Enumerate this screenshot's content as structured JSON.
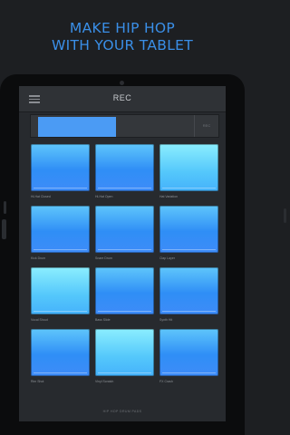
{
  "promo": {
    "line1": "MAKE HIP HOP",
    "line2": "WITH YOUR TABLET",
    "accent_color": "#3a8fe8"
  },
  "app": {
    "title": "REC",
    "menu_icon": "hamburger-menu-icon",
    "transport_button": "REC",
    "meter_color": "#4b9bf4",
    "pads": [
      {
        "label": "Hi-Hat Closed",
        "style": "blue"
      },
      {
        "label": "Hi-Hat Open",
        "style": "blue"
      },
      {
        "label": "Hat Variation",
        "style": "light"
      },
      {
        "label": "Kick Drum",
        "style": "blue"
      },
      {
        "label": "Snare Drum",
        "style": "blue"
      },
      {
        "label": "Clap Layer",
        "style": "blue"
      },
      {
        "label": "Vocal Shout",
        "style": "light"
      },
      {
        "label": "Bass Slide",
        "style": "blue"
      },
      {
        "label": "Synth Hit",
        "style": "blue"
      },
      {
        "label": "Rim Shot",
        "style": "blue"
      },
      {
        "label": "Vinyl Scratch",
        "style": "light"
      },
      {
        "label": "FX Crash",
        "style": "blue"
      }
    ],
    "footer": "HIP HOP DRUM PADS"
  }
}
